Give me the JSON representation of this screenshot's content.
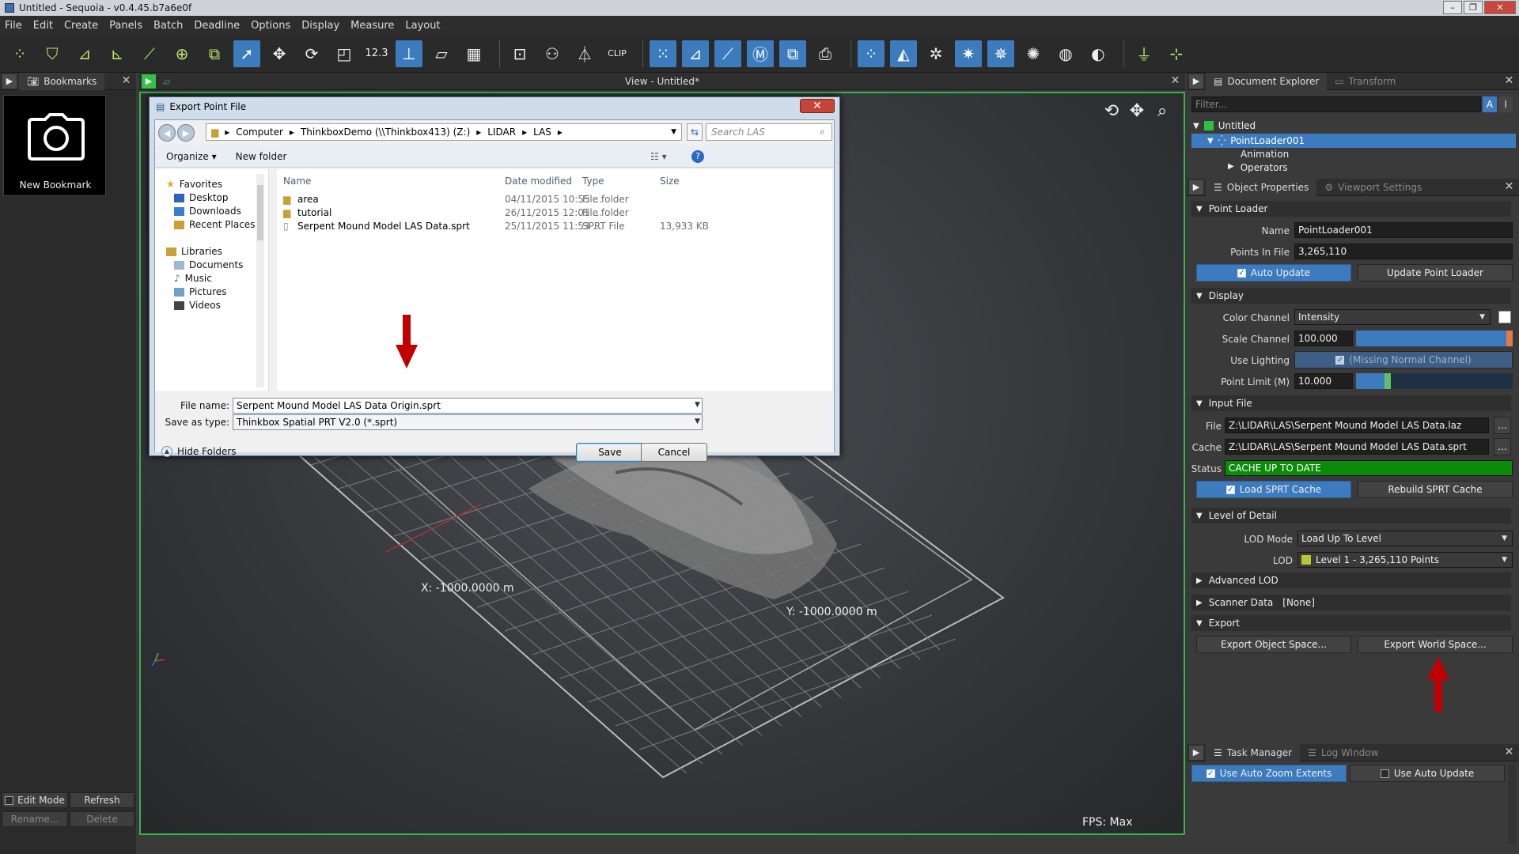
{
  "window": {
    "title": "Untitled - Sequoia - v0.4.45.b7a6e0f"
  },
  "menu": [
    "File",
    "Edit",
    "Create",
    "Panels",
    "Batch",
    "Deadline",
    "Options",
    "Display",
    "Measure",
    "Layout"
  ],
  "left_panel": {
    "tab": "Bookmarks",
    "bookmark_label": "New Bookmark",
    "edit_mode": "Edit Mode",
    "refresh": "Refresh",
    "rename": "Rename...",
    "delete": "Delete"
  },
  "view": {
    "title": "View - Untitled*",
    "x_label": "X:  -1000.0000  m",
    "y_label": "Y:  -1000.0000  m",
    "m_label": "m",
    "fps": "FPS:  Max"
  },
  "dialog": {
    "title": "Export Point File",
    "crumbs": [
      "Computer",
      "ThinkboxDemo (\\\\Thinkbox413) (Z:)",
      "LIDAR",
      "LAS"
    ],
    "search_placeholder": "Search LAS",
    "organize": "Organize",
    "new_folder": "New folder",
    "favorites": "Favorites",
    "fav_items": [
      "Desktop",
      "Downloads",
      "Recent Places"
    ],
    "libraries": "Libraries",
    "lib_items": [
      "Documents",
      "Music",
      "Pictures",
      "Videos"
    ],
    "columns": [
      "Name",
      "Date modified",
      "Type",
      "Size"
    ],
    "files": [
      {
        "name": "area",
        "date": "04/11/2015 10:55 ...",
        "type": "File folder",
        "size": ""
      },
      {
        "name": "tutorial",
        "date": "26/11/2015 12:01 ...",
        "type": "File folder",
        "size": ""
      },
      {
        "name": "Serpent Mound Model LAS Data.sprt",
        "date": "25/11/2015 11:53 ...",
        "type": "SPRT File",
        "size": "13,933 KB"
      }
    ],
    "file_name_label": "File name:",
    "file_name": "Serpent Mound Model LAS Data Origin.sprt",
    "save_type_label": "Save as type:",
    "save_type": "Thinkbox Spatial PRT V2.0 (*.sprt)",
    "hide_folders": "Hide Folders",
    "save": "Save",
    "cancel": "Cancel"
  },
  "doc_explorer": {
    "tab1": "Document Explorer",
    "tab2": "Transform",
    "filter_placeholder": "Filter...",
    "root": "Untitled",
    "node": "PointLoader001",
    "child1": "Animation",
    "child2": "Operators"
  },
  "props": {
    "tab1": "Object Properties",
    "tab2": "Viewport Settings",
    "sec_point_loader": "Point Loader",
    "name_label": "Name",
    "name_value": "PointLoader001",
    "points_label": "Points In File",
    "points_value": "3,265,110",
    "auto_update": "Auto Update",
    "update_loader": "Update Point Loader",
    "sec_display": "Display",
    "color_channel_label": "Color Channel",
    "color_channel": "Intensity",
    "scale_channel_label": "Scale Channel",
    "scale_channel": "100.000",
    "use_lighting_label": "Use Lighting",
    "use_lighting": "(Missing Normal Channel)",
    "point_limit_label": "Point Limit (M)",
    "point_limit": "10.000",
    "sec_input": "Input File",
    "file_label": "File",
    "file_value": "Z:\\LIDAR\\LAS\\Serpent Mound Model LAS Data.laz",
    "cache_label": "Cache",
    "cache_value": "Z:\\LIDAR\\LAS\\Serpent Mound Model LAS Data.sprt",
    "status_label": "Status",
    "status_value": "CACHE UP TO DATE",
    "load_cache": "Load SPRT Cache",
    "rebuild_cache": "Rebuild SPRT Cache",
    "sec_lod": "Level of Detail",
    "lod_mode_label": "LOD Mode",
    "lod_mode": "Load Up To Level",
    "lod_label": "LOD",
    "lod_value": "Level 1 - 3,265,110 Points",
    "sec_adv_lod": "Advanced LOD",
    "sec_scanner": "Scanner Data",
    "scanner_value": "[None]",
    "sec_export": "Export",
    "export_object": "Export Object Space...",
    "export_world": "Export World Space..."
  },
  "task": {
    "tab1": "Task Manager",
    "tab2": "Log Window",
    "auto_zoom": "Use Auto Zoom Extents",
    "auto_update": "Use Auto Update"
  },
  "colors": {
    "accent": "#3d7bbf",
    "viewport_border": "#37b24d",
    "status_green": "#0a8c0a",
    "arrow_red": "#c00000"
  }
}
